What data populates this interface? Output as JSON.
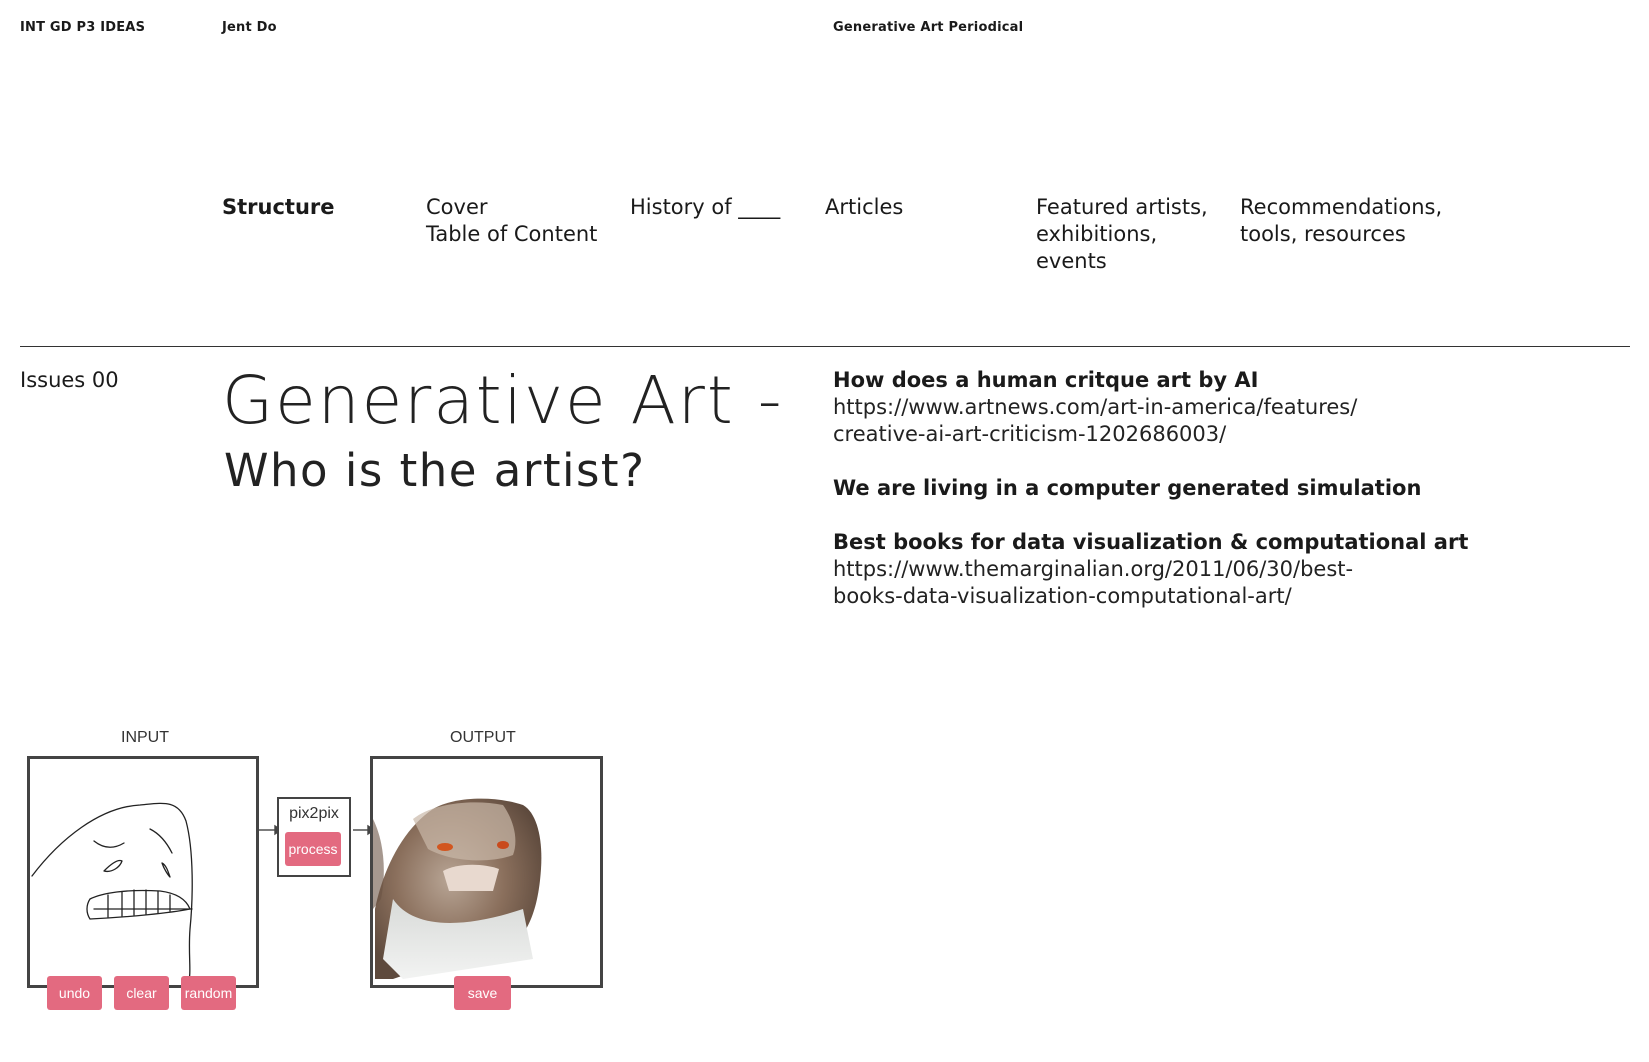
{
  "header": {
    "course": "INT GD P3 IDEAS",
    "author": "Jent Do",
    "project": "Generative Art Periodical"
  },
  "structure": {
    "heading": "Structure",
    "columns": [
      {
        "lines": [
          "Cover",
          "Table of Content"
        ]
      },
      {
        "lines": [
          "History of ____"
        ]
      },
      {
        "lines": [
          "Articles"
        ]
      },
      {
        "lines": [
          "Featured artists,",
          "exhibitions,",
          "events"
        ]
      },
      {
        "lines": [
          "Recommendations,",
          "tools, resources"
        ]
      }
    ]
  },
  "issue": {
    "label": "Issues 00",
    "title": "Generative Art -",
    "subtitle": "Who is the artist?"
  },
  "references": [
    {
      "question": "How does a human critque art by AI",
      "url_lines": [
        "https://www.artnews.com/art-in-america/features/",
        "creative-ai-art-criticism-1202686003/"
      ]
    },
    {
      "question": "We are living in a computer generated simulation",
      "url_lines": []
    },
    {
      "question": "Best books for data visualization & computational art",
      "url_lines": [
        "https://www.themarginalian.org/2011/06/30/best-",
        "books-data-visualization-computational-art/"
      ]
    }
  ],
  "figure": {
    "input_label": "INPUT",
    "output_label": "OUTPUT",
    "model_label": "pix2pix",
    "process_button": "process",
    "undo_button": "undo",
    "clear_button": "clear",
    "random_button": "random",
    "save_button": "save",
    "accent_color": "#e36a80",
    "frame_color": "#444444"
  }
}
